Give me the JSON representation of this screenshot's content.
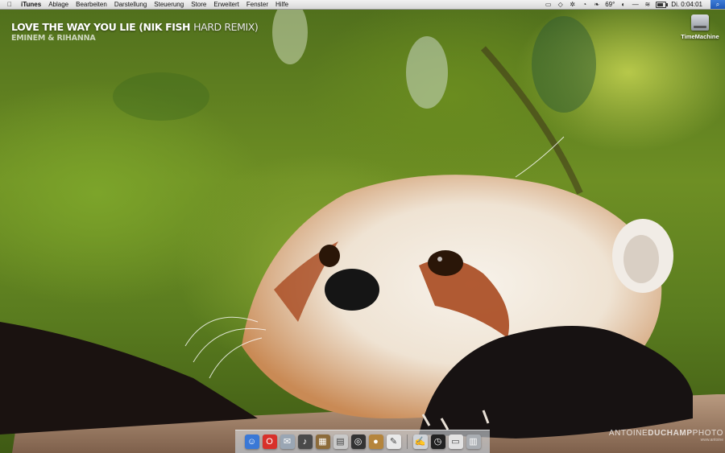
{
  "menubar": {
    "apple_icon": "apple-logo",
    "app_name": "iTunes",
    "menus": [
      "Ablage",
      "Bearbeiten",
      "Darstellung",
      "Steuerung",
      "Store",
      "Erweitert",
      "Fenster",
      "Hilfe"
    ],
    "tray_icons": [
      "display-icon",
      "dropbox-icon",
      "fan-icon",
      "time-machine-icon",
      "growl-icon"
    ],
    "temperature": "69°",
    "clock": "Di. 0:04:01",
    "battery_level": 0.8
  },
  "now_playing": {
    "title_main": "LOVE THE WAY YOU LIE (NIK FISH",
    "title_accent": "HARD REMIX)",
    "artist": "EMINEM & RIHANNA"
  },
  "desktop": {
    "drive_label": "TimeMachine"
  },
  "watermark": {
    "name_light": "ANTOINE",
    "name_bold": "DUCHAMP",
    "name_tail": "PHOTO",
    "url": "www.antoine"
  },
  "dock": {
    "items": [
      {
        "name": "finder-icon",
        "color": "#3a78d6",
        "glyph": "☺"
      },
      {
        "name": "opera-icon",
        "color": "#d8312a",
        "glyph": "O"
      },
      {
        "name": "mail-icon",
        "color": "#9aa6b4",
        "glyph": "✉"
      },
      {
        "name": "itunes-icon",
        "color": "#4a4a4a",
        "glyph": "♪"
      },
      {
        "name": "photo-icon",
        "color": "#8c6b3a",
        "glyph": "▦"
      },
      {
        "name": "finder-window-icon",
        "color": "#c9c9c9",
        "glyph": "▤"
      },
      {
        "name": "aperture-icon",
        "color": "#333333",
        "glyph": "◎"
      },
      {
        "name": "cookie-icon",
        "color": "#b5853c",
        "glyph": "●"
      },
      {
        "name": "notes-icon",
        "color": "#e9e9e9",
        "glyph": "✎"
      },
      {
        "name": "text-edit-icon",
        "color": "#cfd3d8",
        "glyph": "✍"
      },
      {
        "name": "clock-icon",
        "color": "#222222",
        "glyph": "◷"
      },
      {
        "name": "preview-icon",
        "color": "#e3e3e3",
        "glyph": "▭"
      },
      {
        "name": "trash-icon",
        "color": "#a9adb2",
        "glyph": "▥"
      }
    ]
  }
}
